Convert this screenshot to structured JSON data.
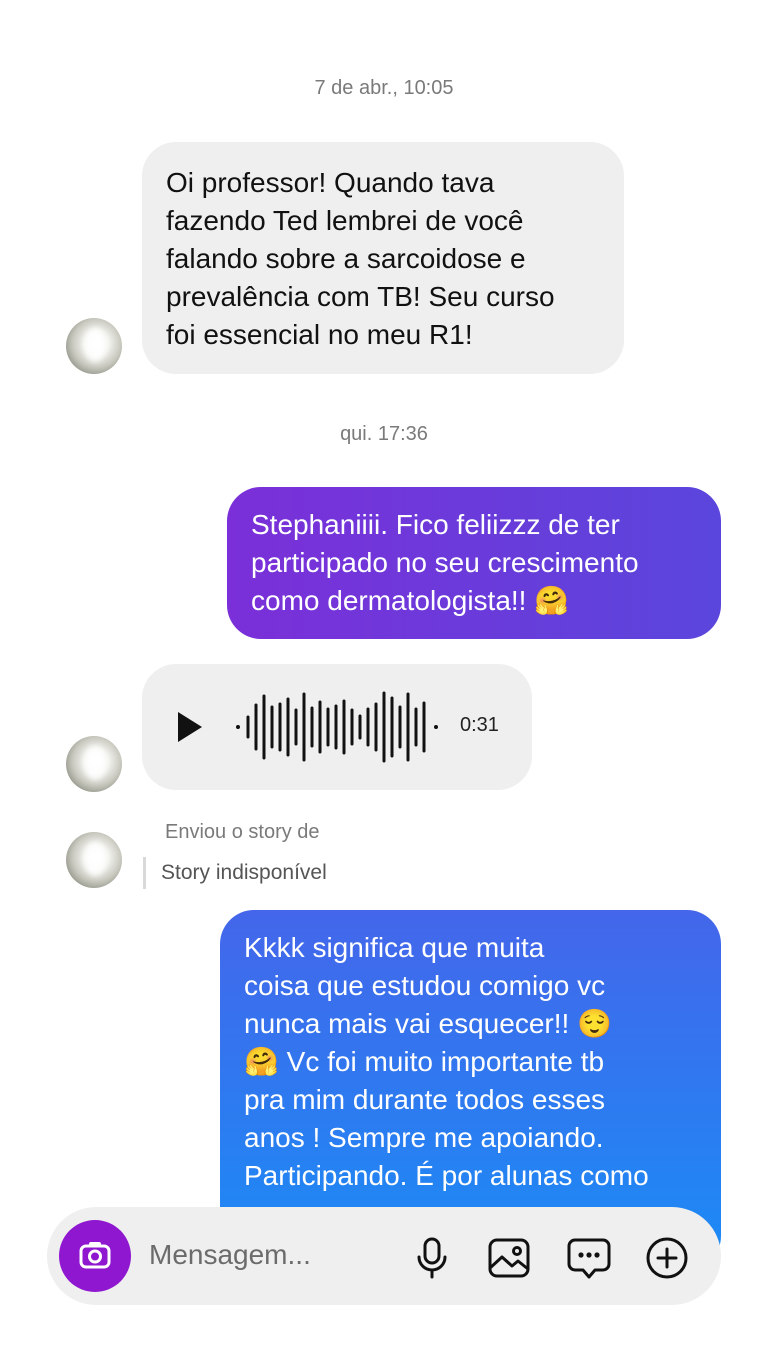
{
  "conversation": {
    "timestamp_1": "7 de abr., 10:05",
    "incoming_1": "Oi professor! Quando tava\nfazendo Ted lembrei de você\nfalando sobre a sarcoidose e\nprevalência com TB! Seu curso\nfoi essencial no meu R1!",
    "timestamp_2": "qui. 17:36",
    "outgoing_1": "Stephaniiii. Fico feliizzz de ter\nparticipado no seu crescimento\ncomo dermatologista!! 🤗",
    "audio": {
      "duration": "0:31",
      "play_icon": "play-icon"
    },
    "story": {
      "title": "Enviou o story de",
      "unavailable": "Story indisponível"
    },
    "outgoing_2": "Kkkk significa que muita\ncoisa que estudou comigo vc\nnunca mais vai esquecer!! 😌\n🤗 Vc foi muito importante tb\npra mim durante todos esses\nanos ! Sempre me apoiando.\nParticipando. É por alunas como"
  },
  "composer": {
    "placeholder": "Mensagem...",
    "icons": [
      "camera-icon",
      "microphone-icon",
      "gallery-icon",
      "sticker-chat-icon",
      "add-circle-icon"
    ]
  },
  "colors": {
    "outgoing_1_gradient": [
      "#7b2fd8",
      "#5a46dc"
    ],
    "outgoing_2_gradient": [
      "#4466ea",
      "#1a8cf5"
    ],
    "camera_button": "#8e17cf",
    "incoming_bubble": "#efefef"
  }
}
